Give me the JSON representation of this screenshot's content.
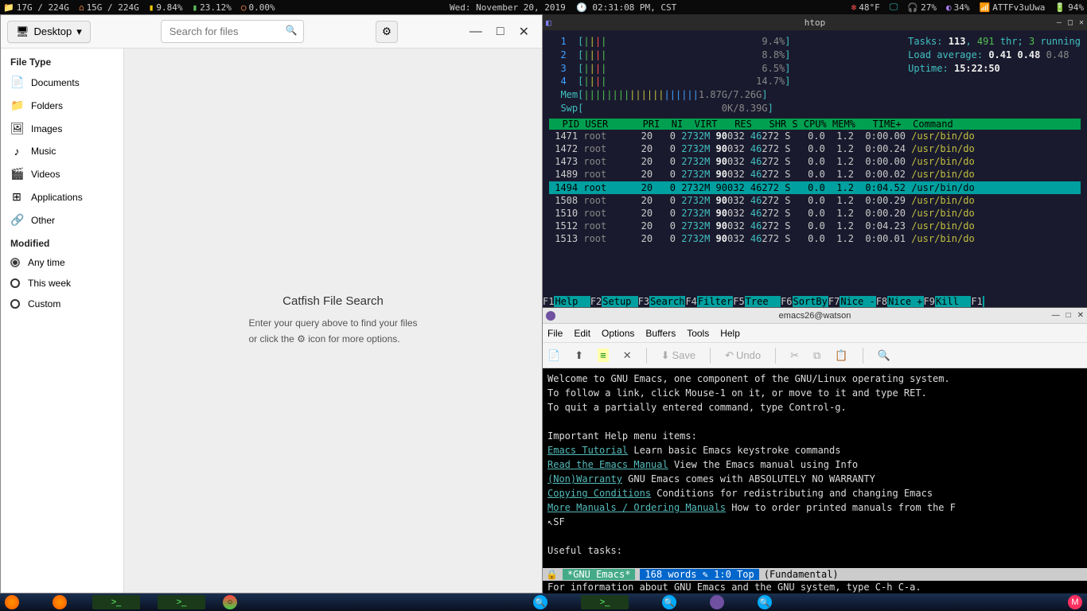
{
  "topbar": {
    "disk1": "17G / 224G",
    "disk2": "15G / 224G",
    "cpu": "9.84%",
    "mem": "23.12%",
    "swap": "0.00%",
    "date": "Wed: November 20, 2019",
    "time": "02:31:08 PM, CST",
    "temp": "48°F",
    "vol": "27%",
    "bright": "34%",
    "wifi": "ATTFv3uUwa",
    "batt": "94%"
  },
  "catfish": {
    "folder_label": "Desktop",
    "search_placeholder": "Search for files",
    "section1": "File Type",
    "types": [
      "Documents",
      "Folders",
      "Images",
      "Music",
      "Videos",
      "Applications",
      "Other"
    ],
    "section2": "Modified",
    "modified": [
      "Any time",
      "This week",
      "Custom"
    ],
    "modified_selected": 0,
    "title": "Catfish File Search",
    "hint1": "Enter your query above to find your files",
    "hint2a": "or click the ",
    "hint2b": " icon for more options."
  },
  "htop": {
    "title": "htop",
    "cpus": [
      {
        "n": "1",
        "bar": "||||",
        "pct": "9.4%"
      },
      {
        "n": "2",
        "bar": "||||",
        "pct": "8.8%"
      },
      {
        "n": "3",
        "bar": "||",
        "pct": "6.5%"
      },
      {
        "n": "4",
        "bar": "|||||",
        "pct": "14.7%"
      }
    ],
    "mem_label": "Mem",
    "mem_bar": "||||||||||||||||||||",
    "mem_val": "1.87G/7.26G",
    "swp_label": "Swp",
    "swp_val": "0K/8.39G",
    "tasks_label": "Tasks:",
    "tasks_n": "113",
    "tasks_thr": "491",
    "tasks_thr_lbl": "thr;",
    "tasks_run": "3",
    "tasks_run_lbl": "running",
    "load_label": "Load average:",
    "load": [
      "0.41",
      "0.48",
      "0.48"
    ],
    "uptime_label": "Uptime:",
    "uptime": "15:22:50",
    "header": "  PID USER      PRI  NI  VIRT   RES   SHR S CPU% MEM%   TIME+  Command",
    "procs": [
      {
        "pid": "1471",
        "user": "root",
        "pri": "20",
        "ni": "0",
        "virt": "2732M",
        "res": "90032",
        "shr": "46272",
        "s": "S",
        "cpu": "0.0",
        "mem": "1.2",
        "time": "0:00.00",
        "cmd": "/usr/bin/do",
        "hl": false
      },
      {
        "pid": "1472",
        "user": "root",
        "pri": "20",
        "ni": "0",
        "virt": "2732M",
        "res": "90032",
        "shr": "46272",
        "s": "S",
        "cpu": "0.0",
        "mem": "1.2",
        "time": "0:00.24",
        "cmd": "/usr/bin/do",
        "hl": false
      },
      {
        "pid": "1473",
        "user": "root",
        "pri": "20",
        "ni": "0",
        "virt": "2732M",
        "res": "90032",
        "shr": "46272",
        "s": "S",
        "cpu": "0.0",
        "mem": "1.2",
        "time": "0:00.00",
        "cmd": "/usr/bin/do",
        "hl": false
      },
      {
        "pid": "1489",
        "user": "root",
        "pri": "20",
        "ni": "0",
        "virt": "2732M",
        "res": "90032",
        "shr": "46272",
        "s": "S",
        "cpu": "0.0",
        "mem": "1.2",
        "time": "0:00.02",
        "cmd": "/usr/bin/do",
        "hl": false
      },
      {
        "pid": "1494",
        "user": "root",
        "pri": "20",
        "ni": "0",
        "virt": "2732M",
        "res": "90032",
        "shr": "46272",
        "s": "S",
        "cpu": "0.0",
        "mem": "1.2",
        "time": "0:04.52",
        "cmd": "/usr/bin/do",
        "hl": true
      },
      {
        "pid": "1508",
        "user": "root",
        "pri": "20",
        "ni": "0",
        "virt": "2732M",
        "res": "90032",
        "shr": "46272",
        "s": "S",
        "cpu": "0.0",
        "mem": "1.2",
        "time": "0:00.29",
        "cmd": "/usr/bin/do",
        "hl": false
      },
      {
        "pid": "1510",
        "user": "root",
        "pri": "20",
        "ni": "0",
        "virt": "2732M",
        "res": "90032",
        "shr": "46272",
        "s": "S",
        "cpu": "0.0",
        "mem": "1.2",
        "time": "0:00.20",
        "cmd": "/usr/bin/do",
        "hl": false
      },
      {
        "pid": "1512",
        "user": "root",
        "pri": "20",
        "ni": "0",
        "virt": "2732M",
        "res": "90032",
        "shr": "46272",
        "s": "S",
        "cpu": "0.0",
        "mem": "1.2",
        "time": "0:04.23",
        "cmd": "/usr/bin/do",
        "hl": false
      },
      {
        "pid": "1513",
        "user": "root",
        "pri": "20",
        "ni": "0",
        "virt": "2732M",
        "res": "90032",
        "shr": "46272",
        "s": "S",
        "cpu": "0.0",
        "mem": "1.2",
        "time": "0:00.01",
        "cmd": "/usr/bin/do",
        "hl": false
      }
    ],
    "fkeys": [
      {
        "k": "F1",
        "l": "Help  "
      },
      {
        "k": "F2",
        "l": "Setup "
      },
      {
        "k": "F3",
        "l": "Search"
      },
      {
        "k": "F4",
        "l": "Filter"
      },
      {
        "k": "F5",
        "l": "Tree  "
      },
      {
        "k": "F6",
        "l": "SortBy"
      },
      {
        "k": "F7",
        "l": "Nice -"
      },
      {
        "k": "F8",
        "l": "Nice +"
      },
      {
        "k": "F9",
        "l": "Kill  "
      },
      {
        "k": "F1",
        "l": ""
      }
    ]
  },
  "emacs": {
    "title": "emacs26@watson",
    "menu": [
      "File",
      "Edit",
      "Options",
      "Buffers",
      "Tools",
      "Help"
    ],
    "toolbar": {
      "save": "Save",
      "undo": "Undo"
    },
    "body": {
      "l1": "Welcome to GNU Emacs, one component of the GNU/Linux operating system.",
      "l2": "To follow a link, click Mouse-1 on it, or move to it and type RET.",
      "l3": "To quit a partially entered command, type Control-g.",
      "l4": "Important Help menu items:",
      "links": [
        {
          "a": "Emacs Tutorial",
          "d": "Learn basic Emacs keystroke commands"
        },
        {
          "a": "Read the Emacs Manual",
          "d": "View the Emacs manual using Info"
        },
        {
          "a": "(Non)Warranty",
          "d": "GNU Emacs comes with ABSOLUTELY NO WARRANTY"
        },
        {
          "a": "Copying Conditions",
          "d": "Conditions for redistributing and changing Emacs"
        },
        {
          "a": "More Manuals / Ordering Manuals",
          "d": "How to order printed manuals from the F"
        }
      ],
      "sf": "SF",
      "l5": "Useful tasks:"
    },
    "modeline": {
      "lock": "🔒",
      "buf": "*GNU Emacs*",
      "wc": "168 words",
      "pos": "1:0 Top",
      "mode": "(Fundamental)"
    },
    "minibuf": "For information about GNU Emacs and the GNU system, type C-h C-a."
  }
}
